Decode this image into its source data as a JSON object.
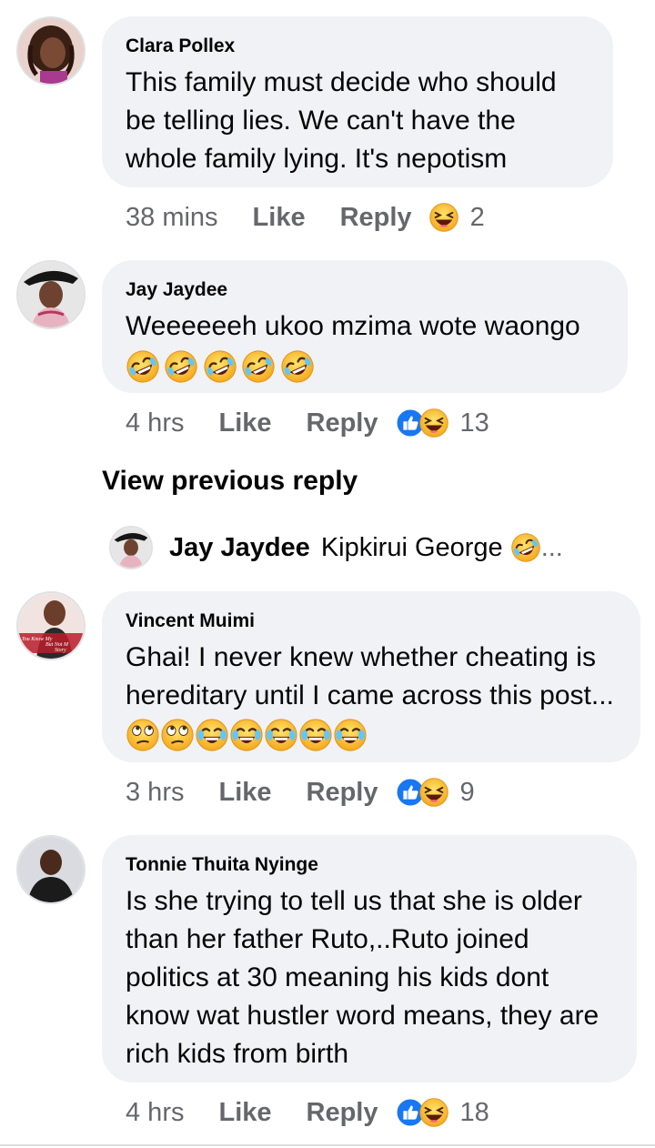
{
  "comments": [
    {
      "author": "Clara Pollex",
      "text": "This family must decide who should be telling lies. We can't have the whole family lying. It's nepotism",
      "time": "38 mins",
      "like": "Like",
      "reply": "Reply",
      "count": "2",
      "reactions": [
        "haha"
      ]
    },
    {
      "author": "Jay Jaydee",
      "text": "Weeeeeeh ukoo mzima wote waongo",
      "time": "4 hrs",
      "like": "Like",
      "reply": "Reply",
      "count": "13",
      "reactions": [
        "like",
        "haha"
      ]
    },
    {
      "author": "Vincent Muimi",
      "text": "Ghai! I never knew whether cheating is hereditary until I came across this post...",
      "time": "3 hrs",
      "like": "Like",
      "reply": "Reply",
      "count": "9",
      "reactions": [
        "like",
        "haha"
      ]
    },
    {
      "author": "Tonnie Thuita Nyinge",
      "text": "Is she trying to tell us that she is older than her father Ruto,..Ruto joined politics at 30 meaning his kids dont know wat hustler word means, they are rich kids from birth",
      "time": "4 hrs",
      "like": "Like",
      "reply": "Reply",
      "count": "18",
      "reactions": [
        "like",
        "haha"
      ]
    }
  ],
  "view_previous": "View previous reply",
  "reply_preview": {
    "author": "Jay Jaydee",
    "text": "Kipkirui George",
    "ellipsis": "..."
  },
  "avatar_texts": {
    "vincent_line1": "You Know My",
    "vincent_line2": "But Not M",
    "vincent_line3": "Story"
  },
  "colors": {
    "bubble": "#f0f2f5",
    "meta": "#65676b",
    "like_blue": "#1877f2",
    "emoji_yellow": "#f7c531"
  }
}
